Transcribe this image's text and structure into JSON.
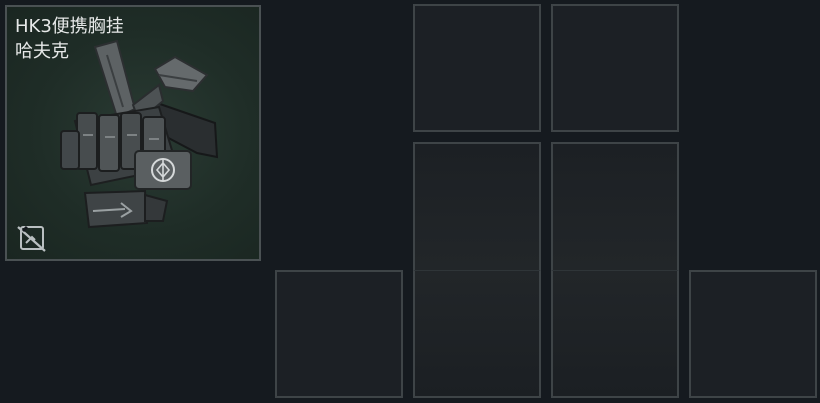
{
  "item": {
    "name": "HK3便携胸挂",
    "brand": "哈夫克",
    "image_icon": "chest-rig-icon",
    "badge_icon": "no-trade-icon"
  },
  "grid": {
    "slot_count": 8,
    "slots": [
      "top-left",
      "top-right",
      "middle-left",
      "middle-right",
      "bottom-1",
      "bottom-2",
      "bottom-3",
      "bottom-4"
    ]
  },
  "colors": {
    "background": "#151a1f",
    "slot_fill": "#1c2025",
    "slot_border": "#3e4447",
    "card_fill": "#1f2d27",
    "card_border": "#4a5153",
    "text": "#e6e8e8"
  }
}
